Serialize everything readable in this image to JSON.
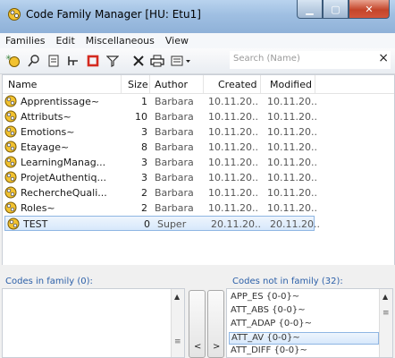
{
  "window": {
    "title": "Code Family Manager [HU: Etu1]"
  },
  "menu": [
    "Families",
    "Edit",
    "Miscellaneous",
    "View"
  ],
  "toolbar": {
    "search_placeholder": "Search (Name)",
    "search_clear": "×"
  },
  "columns": {
    "name": "Name",
    "size": "Size",
    "author": "Author",
    "created": "Created",
    "modified": "Modified"
  },
  "rows": [
    {
      "name": "Apprentissage~",
      "size": "1",
      "author": "Barbara",
      "created": "10.11.20...",
      "modified": "10.11.20..."
    },
    {
      "name": "Attributs~",
      "size": "10",
      "author": "Barbara",
      "created": "10.11.20...",
      "modified": "10.11.20..."
    },
    {
      "name": "Emotions~",
      "size": "3",
      "author": "Barbara",
      "created": "10.11.20...",
      "modified": "10.11.20..."
    },
    {
      "name": "Etayage~",
      "size": "8",
      "author": "Barbara",
      "created": "10.11.20...",
      "modified": "10.11.20..."
    },
    {
      "name": "LearningManag...",
      "size": "3",
      "author": "Barbara",
      "created": "10.11.20...",
      "modified": "10.11.20..."
    },
    {
      "name": "ProjetAuthentiq...",
      "size": "3",
      "author": "Barbara",
      "created": "10.11.20...",
      "modified": "10.11.20..."
    },
    {
      "name": "RechercheQuali...",
      "size": "2",
      "author": "Barbara",
      "created": "10.11.20...",
      "modified": "10.11.20..."
    },
    {
      "name": "Roles~",
      "size": "2",
      "author": "Barbara",
      "created": "10.11.20...",
      "modified": "10.11.20..."
    },
    {
      "name": "TEST",
      "size": "0",
      "author": "Super",
      "created": "20.11.20...",
      "modified": "20.11.20..."
    }
  ],
  "selected_row": "TEST",
  "panels": {
    "in_family_label": "Codes in family (0):",
    "not_in_family_label": "Codes not in family (32):"
  },
  "buttons": {
    "move_left": "<",
    "move_right": ">"
  },
  "codes_not_in_family": [
    "APP_ES {0-0}~",
    "ATT_ABS {0-0}~",
    "ATT_ADAP {0-0}~",
    "ATT_AV {0-0}~",
    "ATT_DIFF {0-0}~"
  ],
  "selected_code": "ATT_AV {0-0}~",
  "colors": {
    "selection_border": "#8fb6e3",
    "panel_label": "#2b5fa8",
    "icon_yellow": "#f2c230",
    "toolbar_red": "#d42a1f"
  }
}
